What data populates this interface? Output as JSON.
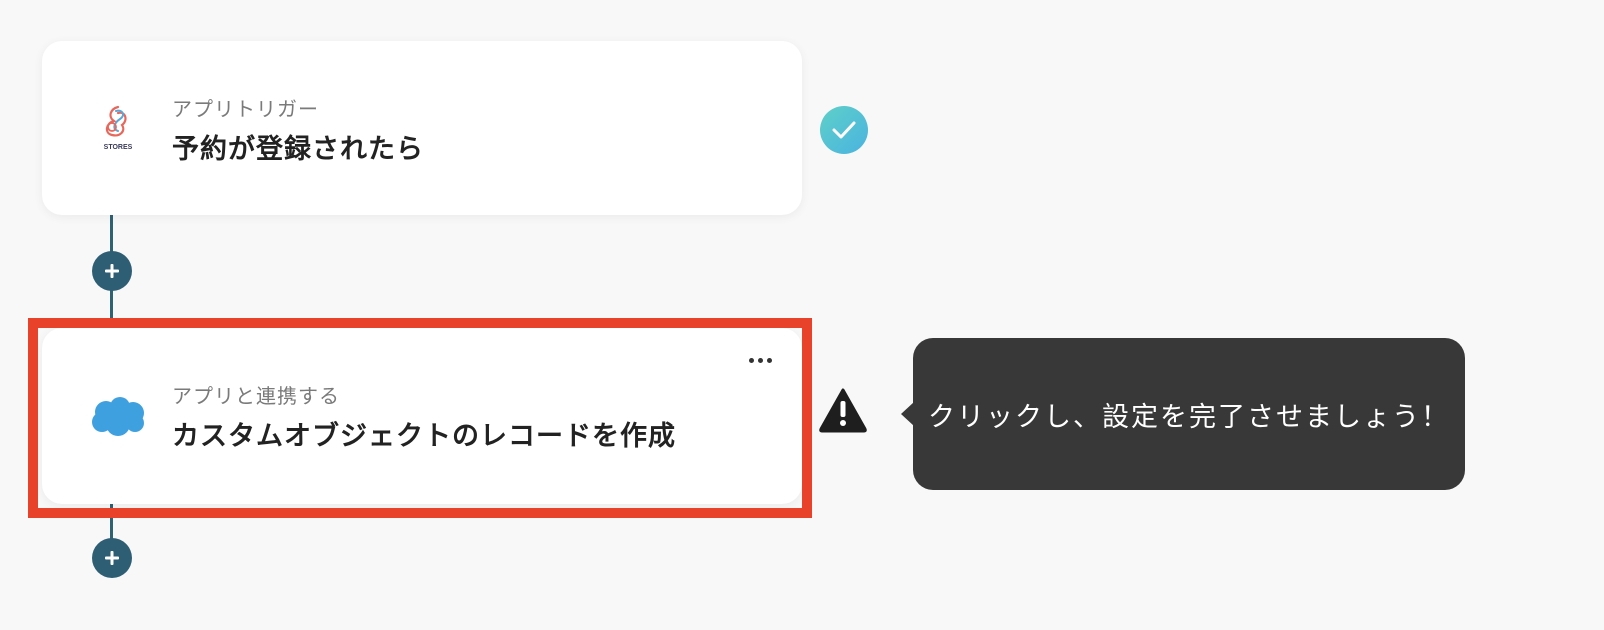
{
  "flow": {
    "trigger": {
      "subtitle": "アプリトリガー",
      "title": "予約が登録されたら",
      "app_icon": "stores-logo",
      "app_logo_text": "STORES",
      "status": "complete"
    },
    "action": {
      "subtitle": "アプリと連携する",
      "title": "カスタムオブジェクトのレコードを作成",
      "app_icon": "salesforce-cloud-logo",
      "status": "warning"
    },
    "tooltip": {
      "text": "クリックし、設定を完了させましょう！"
    }
  },
  "colors": {
    "background": "#f8f8f8",
    "connector": "#2f6273",
    "plus_button": "#2e5e74",
    "highlight": "#e8432a",
    "check_start": "#5fd0c8",
    "check_end": "#4ab3e0",
    "tooltip_bg": "#383838",
    "salesforce_blue": "#3fa0e0"
  }
}
